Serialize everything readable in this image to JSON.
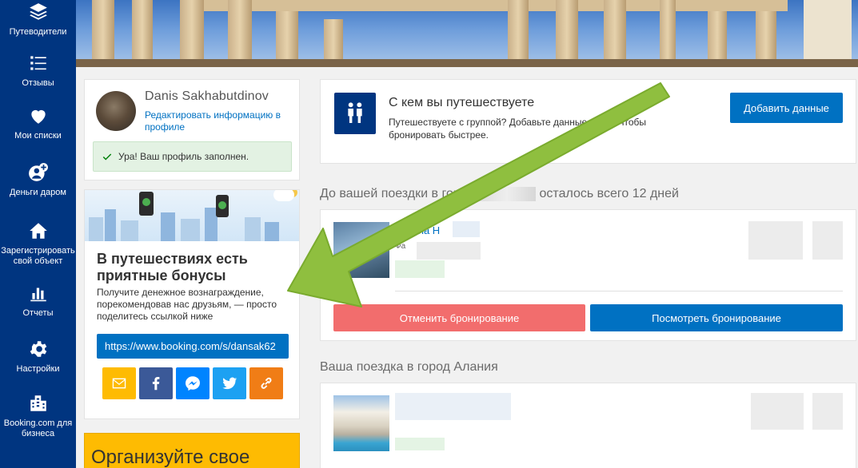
{
  "sidebar": {
    "items": [
      {
        "label": "Путеводители",
        "icon": "layers-icon"
      },
      {
        "label": "Отзывы",
        "icon": "list-icon"
      },
      {
        "label": "Мои списки",
        "icon": "heart-icon"
      },
      {
        "label": "Деньги даром",
        "icon": "user-plus-icon"
      },
      {
        "label": "Зарегистрировать свой объект",
        "icon": "home-icon"
      },
      {
        "label": "Отчеты",
        "icon": "bar-chart-icon"
      },
      {
        "label": "Настройки",
        "icon": "gear-icon"
      },
      {
        "label": "Booking.com для бизнеса",
        "icon": "buildings-icon"
      }
    ]
  },
  "profile": {
    "name": "Danis Sakhabutdinov",
    "edit_link": "Редактировать информацию в профиле",
    "success_message": "Ура! Ваш профиль заполнен."
  },
  "referral": {
    "title": "В путешествиях есть приятные бонусы",
    "text": "Получите денежное вознаграждение, порекомендовав нас друзьям, — просто поделитесь ссылкой ниже",
    "link": "https://www.booking.com/s/dansak62",
    "share_colors": {
      "email": "#febb02",
      "facebook": "#3b5998",
      "messenger": "#0084ff",
      "twitter": "#1da1f2",
      "copy": "#f07d16"
    }
  },
  "organize": {
    "text": "Организуйте свое"
  },
  "travel_companions": {
    "title": "С кем вы путешествуете",
    "subtitle": "Путешествуете с группой? Добавьте данные о ней, чтобы бронировать быстрее.",
    "button": "Добавить данные"
  },
  "upcoming": {
    "heading_prefix": "До вашей поездки в город",
    "heading_suffix": "осталось всего 12 дней",
    "hotel_name": "Dienna H",
    "hotel_meta": "Фа",
    "cancel_button": "Отменить бронирование",
    "view_button": "Посмотреть бронирование"
  },
  "past": {
    "heading": "Ваша поездка в город Алания"
  }
}
